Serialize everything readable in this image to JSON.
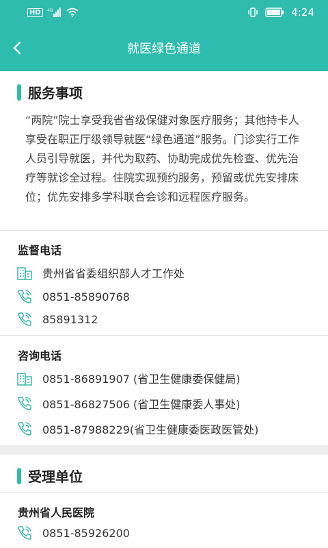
{
  "statusbar": {
    "hd": "HD",
    "signal_label": "4G",
    "time": "4:24"
  },
  "header": {
    "title": "就医绿色通道"
  },
  "service": {
    "title": "服务事项",
    "description": "“两院”院士享受我省省级保健对象医疗服务；其他持卡人享受在职正厅级领导就医“绿色通道”服务。门诊实行工作人员引导就医，并代为取药、协助完成优先检查、优先治疗等就诊全过程。住院实现预约服务，预留或优先安排床位；优先安排多学科联合会诊和远程医疗服务。"
  },
  "supervision": {
    "title": "监督电话",
    "items": [
      {
        "icon": "building-icon",
        "text": "贵州省省委组织部人才工作处"
      },
      {
        "icon": "phone-icon",
        "text": "0851-85890768"
      },
      {
        "icon": "phone-icon",
        "text": "85891312"
      }
    ]
  },
  "consult": {
    "title": "咨询电话",
    "items": [
      {
        "icon": "building-icon",
        "text": "0851-86891907 (省卫生健康委保健局)"
      },
      {
        "icon": "phone-icon",
        "text": "0851-86827506 (省卫生健康委人事处)"
      },
      {
        "icon": "phone-icon",
        "text": "0851-87988229(省卫生健康委医政医管处)"
      }
    ]
  },
  "units": {
    "title": "受理单位",
    "hospital": "贵州省人民医院",
    "phone": "0851-85926200"
  },
  "colors": {
    "accent": "#2ebcae",
    "icon": "#36b9ac"
  }
}
